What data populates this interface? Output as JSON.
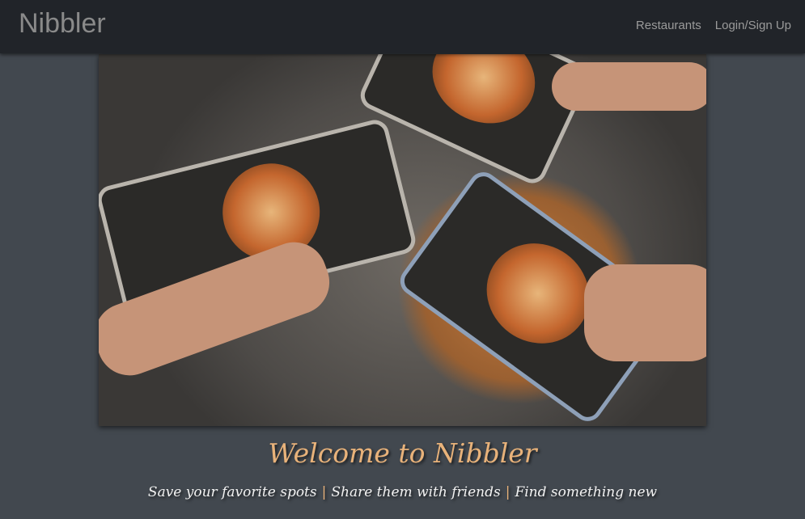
{
  "navbar": {
    "brand": "Nibbler",
    "links": [
      "Restaurants",
      "Login/Sign Up"
    ]
  },
  "hero": {
    "title": "Welcome to Nibbler",
    "taglines": [
      "Save your favorite spots",
      "Share them with friends",
      "Find something new"
    ],
    "separator": "|"
  },
  "colors": {
    "navbar": "#212429",
    "background": "#42484f",
    "accent": "#e8b27a"
  }
}
